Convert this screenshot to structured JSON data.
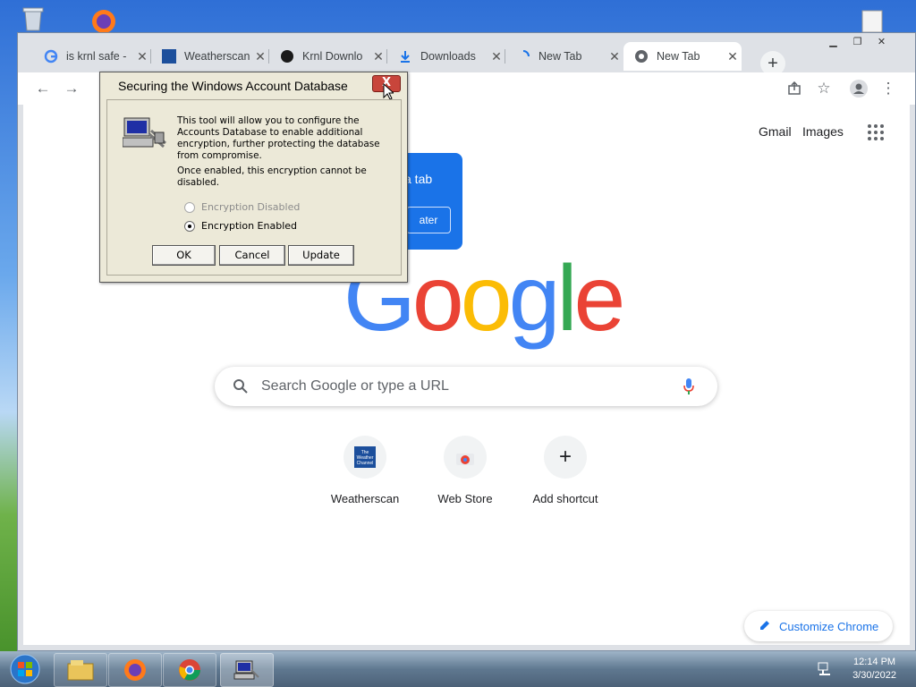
{
  "browser": {
    "tabs": [
      {
        "title": "is krnl safe -",
        "favicon": "google-g-icon"
      },
      {
        "title": "Weatherscan",
        "favicon": "weather-channel-icon"
      },
      {
        "title": "Krnl Downlo",
        "favicon": "krnl-icon"
      },
      {
        "title": "Downloads",
        "favicon": "download-icon"
      },
      {
        "title": "New Tab",
        "favicon": "loading-icon"
      },
      {
        "title": "New Tab",
        "favicon": "chrome-icon",
        "active": true
      }
    ],
    "new_tab_symbol": "+",
    "tab_close_symbol": "✕"
  },
  "ntp": {
    "links": {
      "gmail": "Gmail",
      "images": "Images"
    },
    "promo_text": "a tab",
    "promo_button": "ater",
    "logo_letters": [
      {
        "ch": "G",
        "color": "#4285f4"
      },
      {
        "ch": "o",
        "color": "#ea4335"
      },
      {
        "ch": "o",
        "color": "#fbbc05"
      },
      {
        "ch": "g",
        "color": "#4285f4"
      },
      {
        "ch": "l",
        "color": "#34a853"
      },
      {
        "ch": "e",
        "color": "#ea4335"
      }
    ],
    "search_placeholder": "Search Google or type a URL",
    "shortcuts": [
      {
        "label": "Weatherscan",
        "icon": "weather-channel-icon",
        "icon_text": "The Weather Channel"
      },
      {
        "label": "Web Store",
        "icon": "web-store-icon"
      },
      {
        "label": "Add shortcut",
        "icon": "plus-icon",
        "icon_text": "+"
      }
    ],
    "customize_label": "Customize Chrome"
  },
  "dialog": {
    "title": "Securing the Windows Account Database",
    "close_symbol": "X",
    "description": "This tool will allow you to configure the Accounts Database to enable additional encryption, further protecting the database from compromise.",
    "warning": "Once enabled, this encryption cannot be disabled.",
    "options": [
      {
        "label": "Encryption Disabled",
        "selected": false,
        "enabled": false
      },
      {
        "label": "Encryption Enabled",
        "selected": true,
        "enabled": true
      }
    ],
    "buttons": {
      "ok": "OK",
      "cancel": "Cancel",
      "update": "Update"
    }
  },
  "taskbar": {
    "apps": [
      "file-explorer-icon",
      "firefox-icon",
      "chrome-icon",
      "syskey-icon"
    ],
    "clock": {
      "time": "12:14 PM",
      "date": "3/30/2022"
    }
  },
  "desktop": {
    "icons": [
      "recycle-bin-icon",
      "firefox-icon",
      "document-icon"
    ]
  },
  "colors": {
    "accent": "#1a73e8",
    "tab_strip": "#dee1e6",
    "dialog_bg": "#ece9d8"
  }
}
